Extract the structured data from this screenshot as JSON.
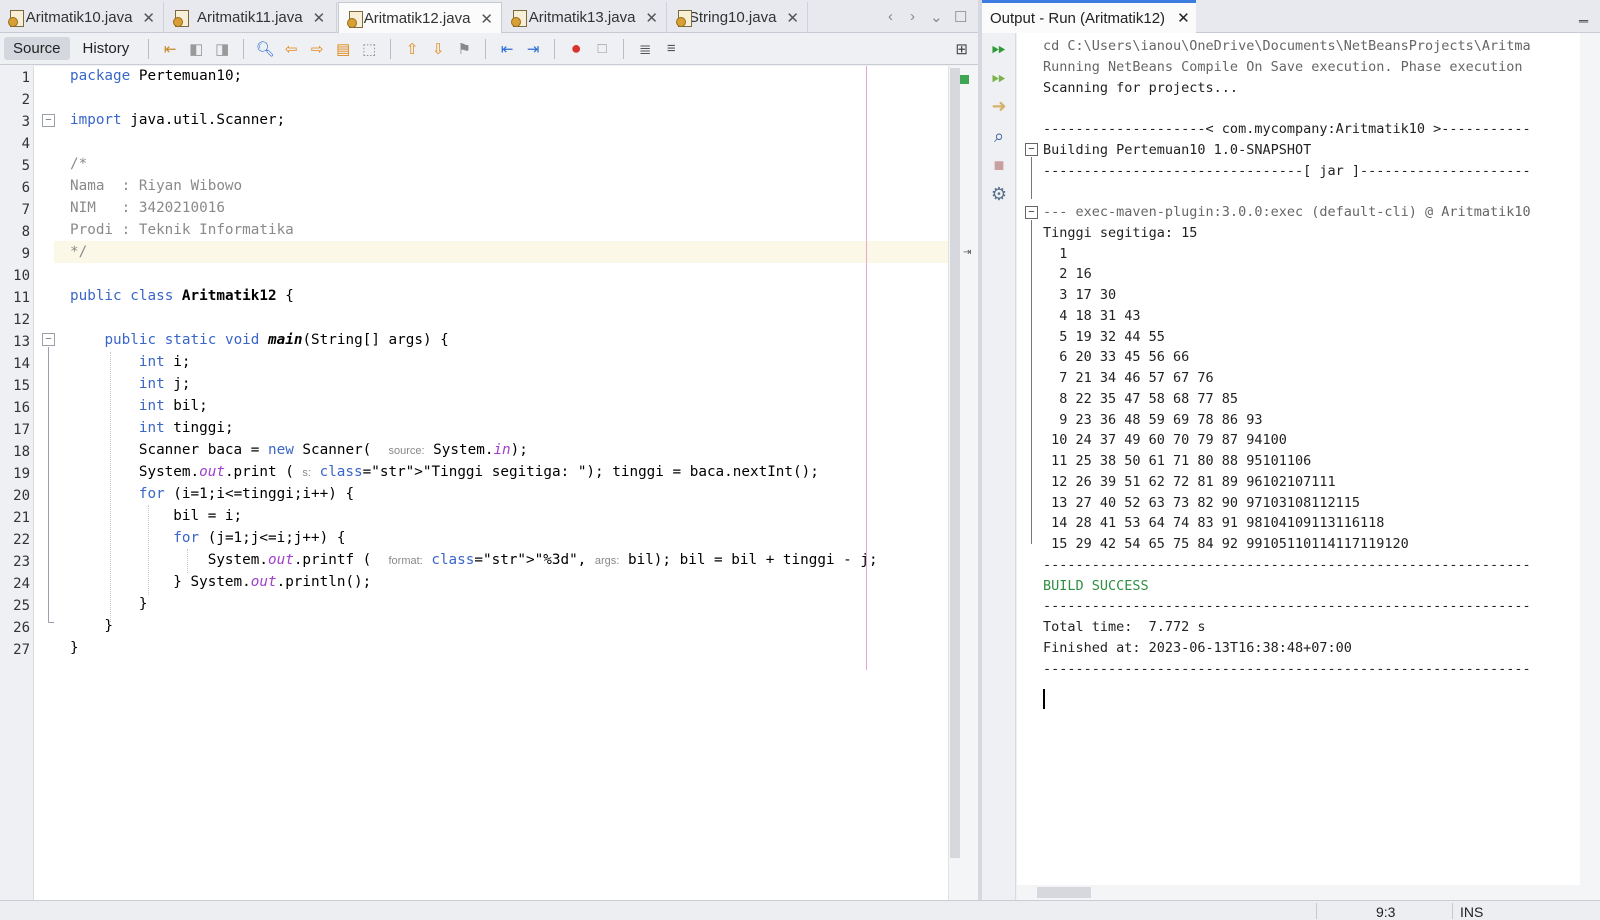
{
  "editor_tabs": [
    {
      "label": "Aritmatik10.java",
      "active": false
    },
    {
      "label": "Aritmatik11.java",
      "active": false
    },
    {
      "label": "Aritmatik12.java",
      "active": true
    },
    {
      "label": "Aritmatik13.java",
      "active": false
    },
    {
      "label": "String10.java",
      "active": false
    }
  ],
  "close_glyph": "✕",
  "output_tab": {
    "label": "Output - Run (Aritmatik12)"
  },
  "toolbar": {
    "source_label": "Source",
    "history_label": "History"
  },
  "code_lines": [
    "package Pertemuan10;",
    "",
    "import java.util.Scanner;",
    "",
    "/*",
    "Nama  : Riyan Wibowo",
    "NIM   : 3420210016",
    "Prodi : Teknik Informatika",
    "*/",
    "",
    "public class Aritmatik12 {",
    "",
    "    public static void main(String[] args) {",
    "        int i;",
    "        int j;",
    "        int bil;",
    "        int tinggi;",
    "        Scanner baca = new Scanner(  source: System.in);",
    "        System.out.print ( s: \"Tinggi segitiga: \"); tinggi = baca.nextInt();",
    "        for (i=1;i<=tinggi;i++) {",
    "            bil = i;",
    "            for (j=1;j<=i;j++) {",
    "                System.out.printf (  format: \"%3d\", args: bil); bil = bil + tinggi - j;",
    "            } System.out.println();",
    "        }",
    "    }",
    "}"
  ],
  "output_lines": [
    "cd C:\\Users\\ianou\\OneDrive\\Documents\\NetBeansProjects\\Aritma",
    "Running NetBeans Compile On Save execution. Phase execution",
    "Scanning for projects...",
    "",
    "--------------------< com.mycompany:Aritmatik10 >-----------",
    "Building Pertemuan10 1.0-SNAPSHOT",
    "--------------------------------[ jar ]---------------------",
    "",
    "--- exec-maven-plugin:3.0.0:exec (default-cli) @ Aritmatik10",
    "Tinggi segitiga: 15",
    "  1",
    "  2 16",
    "  3 17 30",
    "  4 18 31 43",
    "  5 19 32 44 55",
    "  6 20 33 45 56 66",
    "  7 21 34 46 57 67 76",
    "  8 22 35 47 58 68 77 85",
    "  9 23 36 48 59 69 78 86 93",
    " 10 24 37 49 60 70 79 87 94100",
    " 11 25 38 50 61 71 80 88 95101106",
    " 12 26 39 51 62 72 81 89 96102107111",
    " 13 27 40 52 63 73 82 90 97103108112115",
    " 14 28 41 53 64 74 83 91 98104109113116118",
    " 15 29 42 54 65 75 84 92 99105110114117119120",
    "------------------------------------------------------------",
    "BUILD SUCCESS",
    "------------------------------------------------------------",
    "Total time:  7.772 s",
    "Finished at: 2023-06-13T16:38:48+07:00",
    "------------------------------------------------------------"
  ],
  "status": {
    "position": "9:3",
    "mode": "INS"
  },
  "colors": {
    "accent": "#3c7be0",
    "keyword": "#3a66c8",
    "string": "#2e8b57",
    "comment": "#8a8a8a",
    "success": "#2f8f44"
  }
}
